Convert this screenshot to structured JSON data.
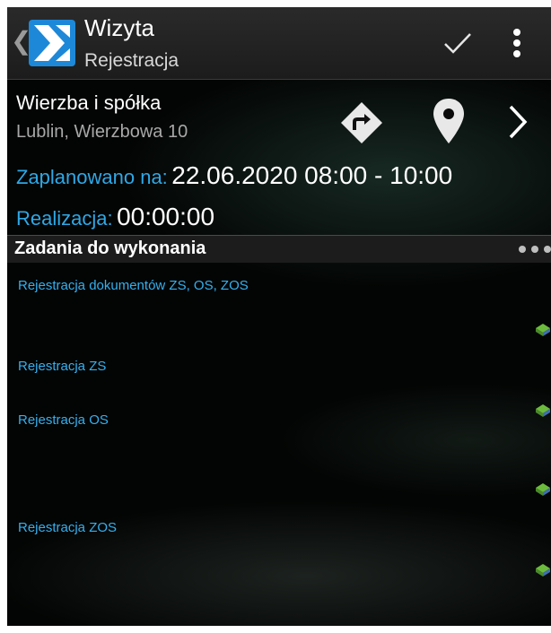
{
  "header": {
    "title": "Wizyta",
    "subtitle": "Rejestracja"
  },
  "customer": {
    "name": "Wierzba i spółka",
    "address": "Lublin, Wierzbowa 10"
  },
  "schedule": {
    "planned_label": "Zaplanowano na:",
    "planned_value": "22.06.2020 08:00 - 10:00",
    "realization_label": "Realizacja:",
    "realization_value": "00:00:00"
  },
  "tasks_section": {
    "title": "Zadania do wykonania",
    "items": [
      {
        "label": "Rejestracja dokumentów ZS, OS, ZOS",
        "icon": "task-status-icon"
      },
      {
        "label": "Rejestracja ZS",
        "icon": "task-status-icon"
      },
      {
        "label": "Rejestracja OS",
        "icon": "task-status-icon"
      },
      {
        "label": "Rejestracja ZOS",
        "icon": "task-status-icon"
      }
    ]
  },
  "icons": {
    "back": "chevron-left-icon",
    "logo": "app-logo",
    "confirm": "check-icon",
    "menu": "more-vertical-icon",
    "directions": "directions-icon",
    "location": "map-pin-icon",
    "next": "chevron-right-icon"
  },
  "colors": {
    "accent": "#2fa8e6",
    "logo_blue": "#1e88d8",
    "action_bar": "#222222",
    "background": "#030504"
  }
}
